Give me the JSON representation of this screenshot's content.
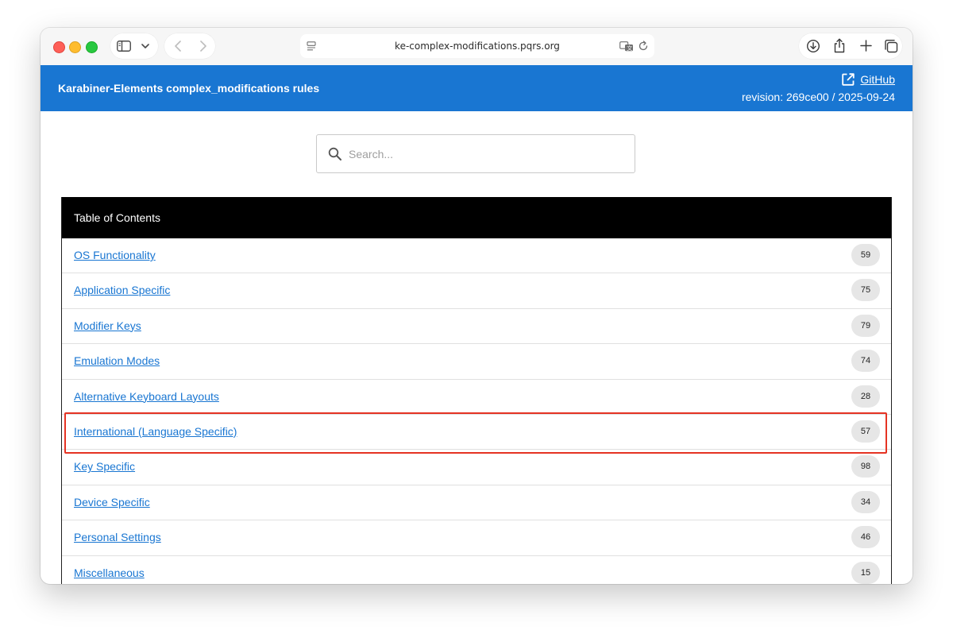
{
  "browser": {
    "url": "ke-complex-modifications.pqrs.org",
    "icons": [
      "sidebar-icon",
      "chevron-down-icon",
      "back-icon",
      "forward-icon",
      "page-menu-icon",
      "translate-icon",
      "reload-icon",
      "download-icon",
      "share-icon",
      "new-tab-icon",
      "tab-overview-icon"
    ]
  },
  "header": {
    "title": "Karabiner-Elements complex_modifications rules",
    "github_label": "GitHub",
    "revision": "revision: 269ce00 / 2025-09-24",
    "color": "#1976d2"
  },
  "search": {
    "placeholder": "Search...",
    "value": ""
  },
  "toc": {
    "title": "Table of Contents",
    "items": [
      {
        "label": "OS Functionality",
        "count": "59"
      },
      {
        "label": "Application Specific",
        "count": "75"
      },
      {
        "label": "Modifier Keys",
        "count": "79"
      },
      {
        "label": "Emulation Modes",
        "count": "74"
      },
      {
        "label": "Alternative Keyboard Layouts",
        "count": "28"
      },
      {
        "label": "International (Language Specific)",
        "count": "57",
        "highlighted": true
      },
      {
        "label": "Key Specific",
        "count": "98"
      },
      {
        "label": "Device Specific",
        "count": "34"
      },
      {
        "label": "Personal Settings",
        "count": "46"
      },
      {
        "label": "Miscellaneous",
        "count": "15"
      }
    ]
  },
  "colors": {
    "link": "#1976d2",
    "highlight": "#e53323",
    "toc_header": "#000000"
  }
}
